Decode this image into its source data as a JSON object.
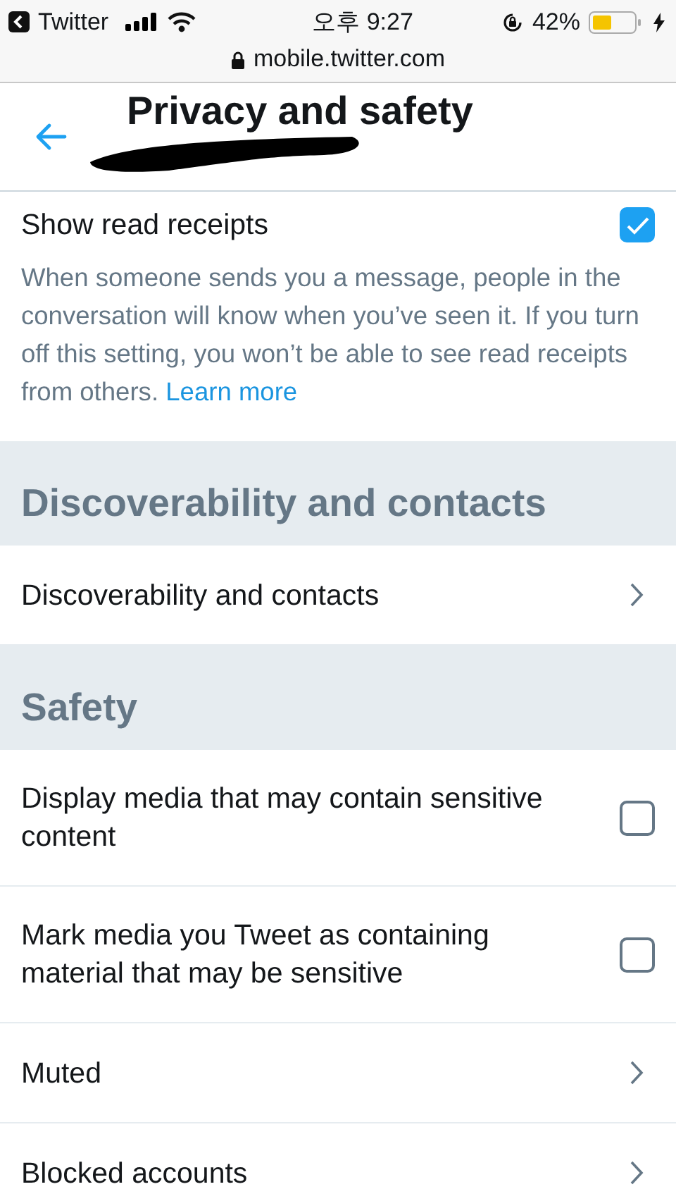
{
  "status_bar": {
    "back_app": "Twitter",
    "time": "오후 9:27",
    "battery": "42%"
  },
  "address_bar": {
    "url": "mobile.twitter.com"
  },
  "header": {
    "title": "Privacy and safety"
  },
  "read_receipts": {
    "label": "Show read receipts",
    "checked": true,
    "description": "When someone sends you a message, people in the conversation will know when you’ve seen it. If you turn off this setting, you won’t be able to see read receipts from others.",
    "link": "Learn more"
  },
  "sections": [
    {
      "title": "Discoverability and contacts",
      "items": [
        {
          "kind": "link",
          "label": "Discoverability and contacts"
        }
      ]
    },
    {
      "title": "Safety",
      "items": [
        {
          "kind": "checkbox",
          "label": "Display media that may contain sensitive content",
          "checked": false
        },
        {
          "kind": "checkbox",
          "label": "Mark media you Tweet as containing material that may be sensitive",
          "checked": false
        },
        {
          "kind": "link",
          "label": "Muted"
        },
        {
          "kind": "link",
          "label": "Blocked accounts"
        }
      ]
    }
  ]
}
